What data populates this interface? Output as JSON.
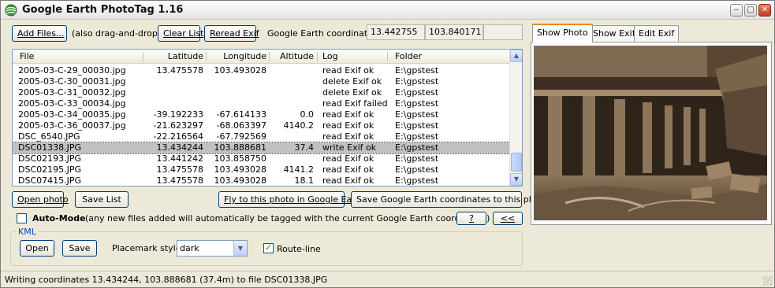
{
  "window": {
    "title": "Google Earth PhotoTag 1.16",
    "controls": {
      "minimize": "‒",
      "maximize": "□",
      "close": "✕"
    }
  },
  "toolbar": {
    "add_files": "Add Files...",
    "add_hint": "(also drag-and-drop)",
    "clear_list": "Clear List",
    "reread_exif": "Reread Exif",
    "coords_label": "Google Earth coordinates:",
    "latitude": "13.442755",
    "longitude": "103.840171",
    "altitude": ""
  },
  "table": {
    "columns": [
      "File",
      "Latitude",
      "Longitude",
      "Altitude",
      "Log",
      "Folder"
    ],
    "rows": [
      {
        "file": "2005-03-C-29_00030.jpg",
        "lat": "13.475578",
        "lon": "103.493028",
        "alt": "",
        "log": "read Exif ok",
        "folder": "E:\\gpstest"
      },
      {
        "file": "2005-03-C-30_00031.jpg",
        "lat": "",
        "lon": "",
        "alt": "",
        "log": "delete Exif ok",
        "folder": "E:\\gpstest"
      },
      {
        "file": "2005-03-C-31_00032.jpg",
        "lat": "",
        "lon": "",
        "alt": "",
        "log": "delete Exif ok",
        "folder": "E:\\gpstest"
      },
      {
        "file": "2005-03-C-33_00034.jpg",
        "lat": "",
        "lon": "",
        "alt": "",
        "log": "read Exif failed",
        "folder": "E:\\gpstest"
      },
      {
        "file": "2005-03-C-34_00035.jpg",
        "lat": "-39.192233",
        "lon": "-67.614133",
        "alt": "0.0",
        "log": "read Exif ok",
        "folder": "E:\\gpstest"
      },
      {
        "file": "2005-03-C-36_00037.jpg",
        "lat": "-21.623297",
        "lon": "-68.063397",
        "alt": "4140.2",
        "log": "read Exif ok",
        "folder": "E:\\gpstest"
      },
      {
        "file": "DSC_6540.JPG",
        "lat": "-22.216564",
        "lon": "-67.792569",
        "alt": "",
        "log": "read Exif ok",
        "folder": "E:\\gpstest"
      },
      {
        "file": "DSC01338.JPG",
        "lat": "13.434244",
        "lon": "103.888681",
        "alt": "37.4",
        "log": "write Exif ok",
        "folder": "E:\\gpstest"
      },
      {
        "file": "DSC02193.JPG",
        "lat": "13.441242",
        "lon": "103.858750",
        "alt": "",
        "log": "read Exif ok",
        "folder": "E:\\gpstest"
      },
      {
        "file": "DSC02195.JPG",
        "lat": "13.475578",
        "lon": "103.493028",
        "alt": "4141.2",
        "log": "read Exif ok",
        "folder": "E:\\gpstest"
      },
      {
        "file": "DSC07415.JPG",
        "lat": "13.475578",
        "lon": "103.493028",
        "alt": "18.1",
        "log": "read Exif ok",
        "folder": "E:\\gpstest"
      }
    ],
    "selected_file": "DSC01338.JPG"
  },
  "actions": {
    "open_photo": "Open photo",
    "save_list": "Save List",
    "fly_to": "Fly to this photo in Google Earth",
    "save_coords": "Save Google Earth coordinates to this photo"
  },
  "automode": {
    "label": "Auto-Mode",
    "hint": "(any new files added will automatically be tagged with the current Google Earth coordinates)",
    "checked": false,
    "help_button": "?",
    "collapse_button": "<<"
  },
  "kml": {
    "legend": "KML",
    "open": "Open",
    "save": "Save",
    "placemark_label": "Placemark style:",
    "placemark_value": "dark",
    "routeline_label": "Route-line",
    "routeline_checked": true
  },
  "tabs": [
    "Show Photo",
    "Show Exif",
    "Edit Exif"
  ],
  "active_tab": "Show Photo",
  "status": "Writing coordinates 13.434244, 103.888681 (37.4m) to file DSC01338.JPG",
  "colors": {
    "accent_tab": "#e68b2c",
    "selection": "#c1c1c1",
    "kml_legend": "#0046d5"
  }
}
